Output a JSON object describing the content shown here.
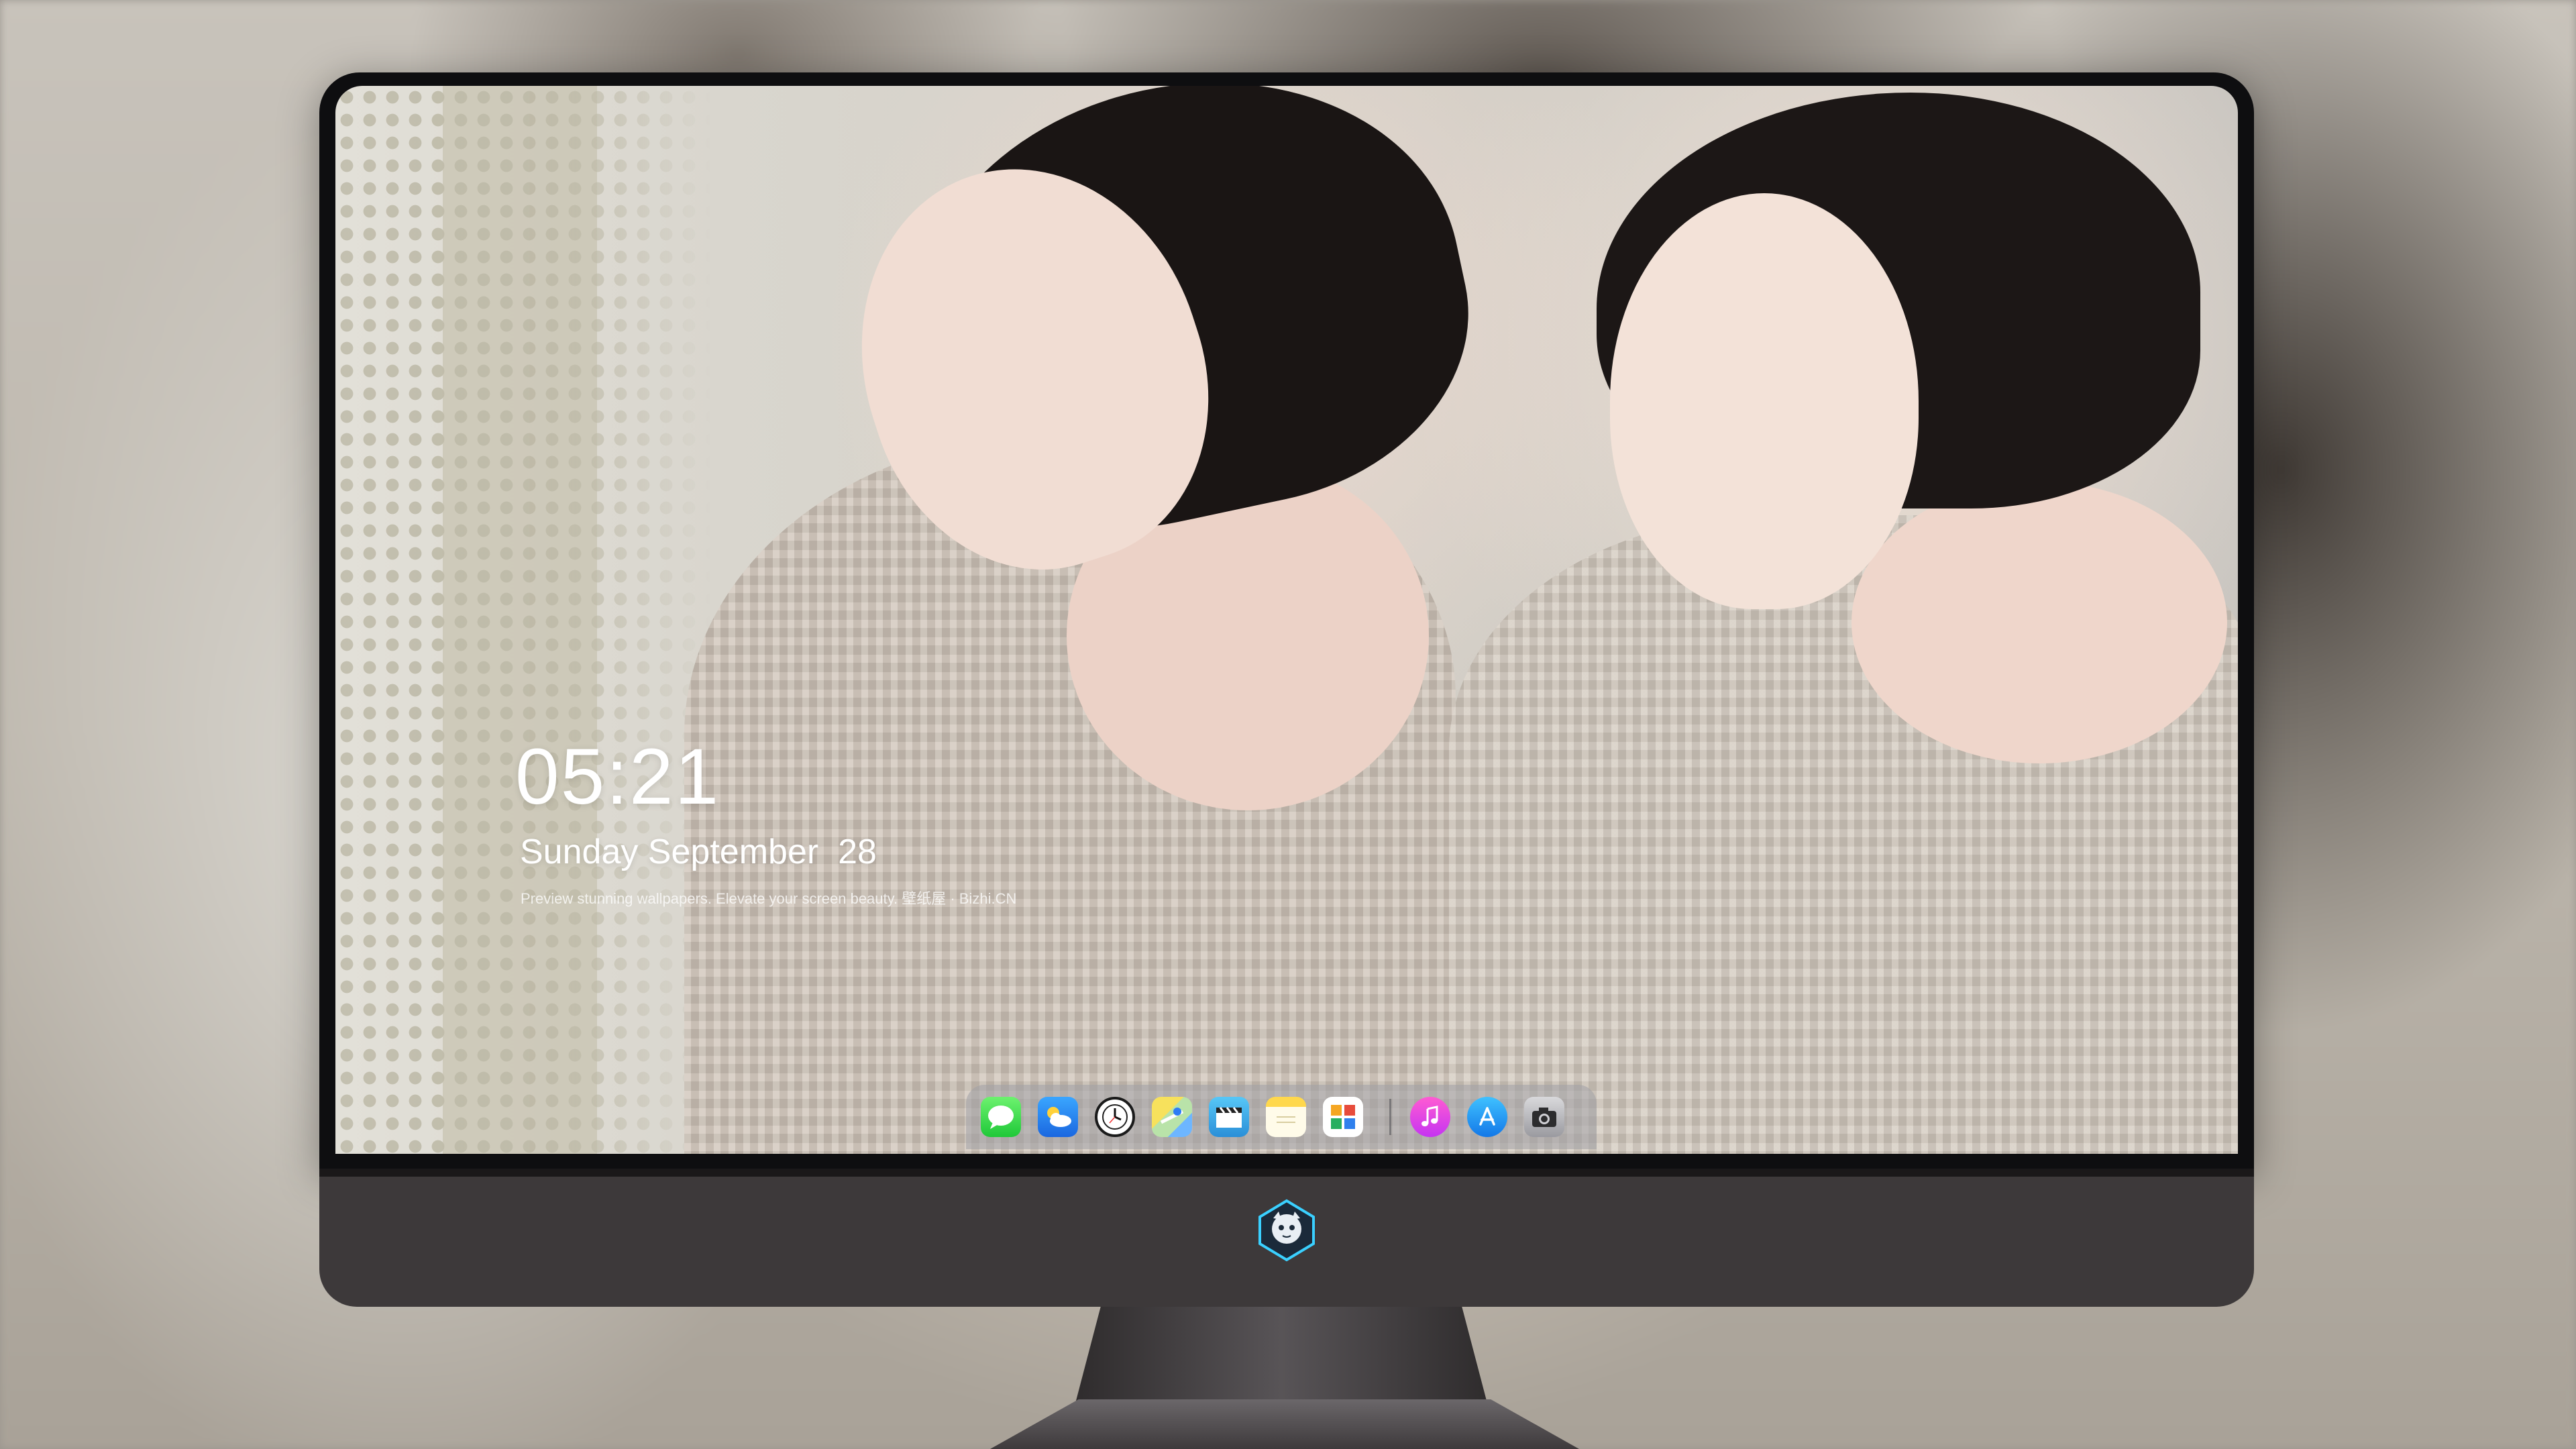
{
  "lockscreen": {
    "time": "05:21",
    "date": "Sunday September  28",
    "tagline": "Preview stunning wallpapers. Elevate your screen beauty. 壁纸屋 · Bizhi.CN"
  },
  "dock": {
    "apps_left": [
      {
        "name": "Messages",
        "icon": "messages-icon"
      },
      {
        "name": "Weather",
        "icon": "weather-icon"
      },
      {
        "name": "Clock",
        "icon": "clock-icon"
      },
      {
        "name": "Maps",
        "icon": "maps-icon"
      },
      {
        "name": "Videos",
        "icon": "clapperboard-icon"
      },
      {
        "name": "Notes",
        "icon": "notes-icon"
      },
      {
        "name": "Photos",
        "icon": "photos-icon"
      }
    ],
    "apps_right": [
      {
        "name": "Music",
        "icon": "music-note-icon"
      },
      {
        "name": "App Store",
        "icon": "app-store-icon"
      },
      {
        "name": "Camera",
        "icon": "camera-icon"
      }
    ]
  },
  "colors": {
    "bezel": "#0e0e10",
    "chin": "#3d393a",
    "clock_text": "#ffffff",
    "dock_bg": "rgba(160,160,165,0.55)"
  }
}
